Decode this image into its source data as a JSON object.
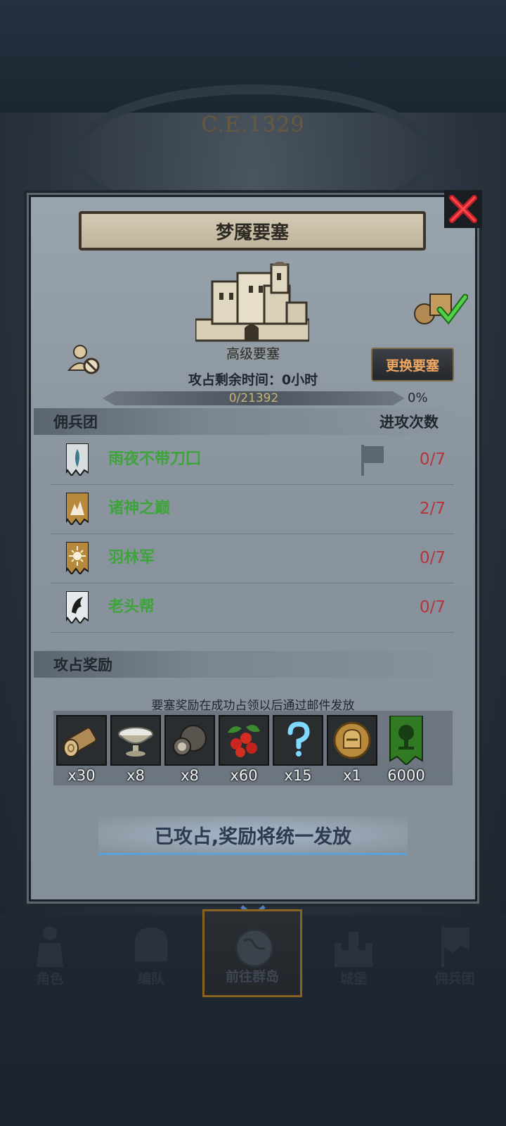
{
  "background": {
    "era_label": "C.E.1329"
  },
  "dialog": {
    "title": "梦魇要塞",
    "fortress_type": "高级要塞",
    "change_button": "更换要塞",
    "time_remaining": "攻占剩余时间：0小时",
    "progress": {
      "text": "0/21392",
      "percent_label": "0%",
      "fraction": 0
    },
    "mercenary_section": {
      "header_left": "佣兵团",
      "header_right": "进攻次数"
    },
    "mercenaries": [
      {
        "name": "雨夜不带刀囗",
        "attacks": "0/7",
        "banner_icon": "feather-banner-icon",
        "has_flag": true
      },
      {
        "name": "诸神之巅",
        "attacks": "2/7",
        "banner_icon": "mountain-banner-icon",
        "has_flag": false
      },
      {
        "name": "羽林军",
        "attacks": "0/7",
        "banner_icon": "sun-banner-icon",
        "has_flag": false
      },
      {
        "name": "老头帮",
        "attacks": "0/7",
        "banner_icon": "wolf-banner-icon",
        "has_flag": false
      }
    ],
    "reward_section": {
      "header": "攻占奖励",
      "note": "要塞奖励在成功占领以后通过邮件发放",
      "items": [
        {
          "icon": "wood-log-icon",
          "qty": "x30"
        },
        {
          "icon": "silver-bowl-icon",
          "qty": "x8"
        },
        {
          "icon": "truffle-icon",
          "qty": "x8"
        },
        {
          "icon": "berries-icon",
          "qty": "x60"
        },
        {
          "icon": "mystery-question-icon",
          "qty": "x15"
        },
        {
          "icon": "helmet-coin-icon",
          "qty": "x1"
        },
        {
          "icon": "tree-banner-icon",
          "qty": "6000"
        }
      ]
    },
    "claimed_status": "已攻占,奖励将统一发放"
  },
  "nav": {
    "items": [
      {
        "label": "角色",
        "active": false
      },
      {
        "label": "编队",
        "active": false
      },
      {
        "label": "前往群岛",
        "active": true
      },
      {
        "label": "城堡",
        "active": false
      },
      {
        "label": "佣兵团",
        "active": false
      }
    ]
  },
  "colors": {
    "accent_green": "#3da43a",
    "count_red": "#b5343a",
    "change_orange": "#f0a860"
  }
}
